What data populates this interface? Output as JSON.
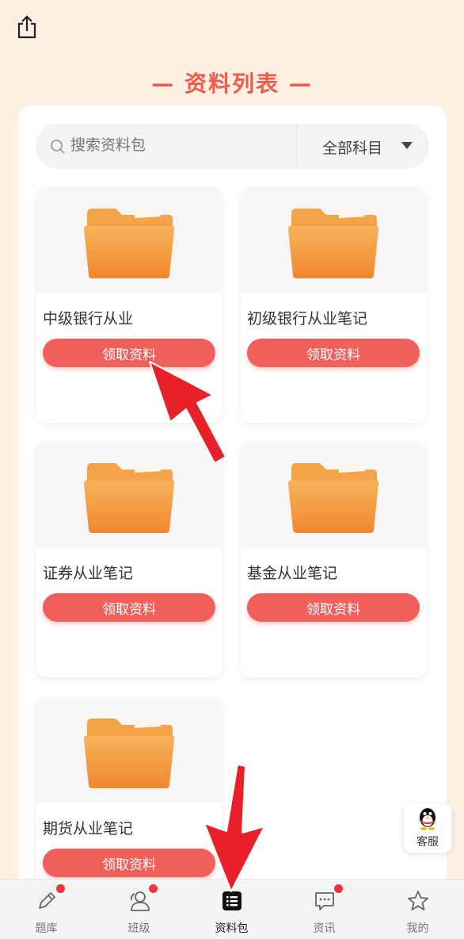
{
  "header": {
    "title": "— 资料列表 —"
  },
  "search": {
    "placeholder": "搜索资料包",
    "subject_filter": "全部科目"
  },
  "cards": [
    {
      "title": "中级银行从业",
      "button": "领取资料"
    },
    {
      "title": "初级银行从业笔记",
      "button": "领取资料"
    },
    {
      "title": "证券从业笔记",
      "button": "领取资料"
    },
    {
      "title": "基金从业笔记",
      "button": "领取资料"
    },
    {
      "title": "期货从业笔记",
      "button": "领取资料"
    }
  ],
  "service": {
    "label": "客服"
  },
  "tabbar": {
    "items": [
      {
        "label": "题库",
        "icon": "pencil-icon",
        "badge": true
      },
      {
        "label": "班级",
        "icon": "people-icon",
        "badge": true
      },
      {
        "label": "资料包",
        "icon": "list-icon",
        "badge": false,
        "active": true
      },
      {
        "label": "资讯",
        "icon": "chat-icon",
        "badge": true
      },
      {
        "label": "我的",
        "icon": "star-icon",
        "badge": false
      }
    ]
  },
  "colors": {
    "accent": "#ef5a4b",
    "button": "#f0605a",
    "background": "#fdf0e3",
    "arrow": "#e8202a"
  }
}
